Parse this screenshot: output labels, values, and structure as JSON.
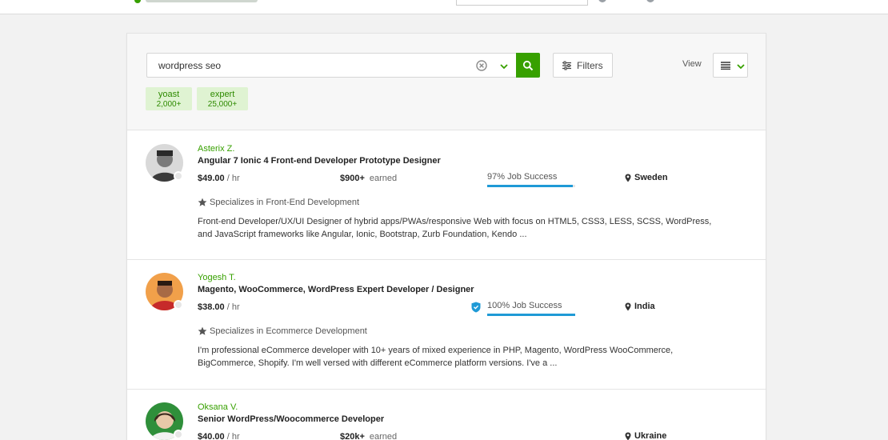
{
  "colors": {
    "brand": "#37a000",
    "success_bar": "#1f9ad6",
    "chip_bg": "#dff3d2"
  },
  "search": {
    "value": "wordpress seo",
    "placeholder": ""
  },
  "toolbar": {
    "filters_label": "Filters",
    "view_label": "View"
  },
  "chips": [
    {
      "name": "yoast",
      "count": "2,000+"
    },
    {
      "name": "expert",
      "count": "25,000+"
    }
  ],
  "results": [
    {
      "name": "Asterix Z.",
      "title": "Angular 7 Ionic 4 Front-end Developer Prototype Designer",
      "rate": "$49.00",
      "rate_unit": " / hr",
      "earned_amount": "$900+",
      "earned_label": "earned",
      "job_success": "97% Job Success",
      "job_success_pct": 97,
      "location": "Sweden",
      "specializes": "Specializes in Front-End Development",
      "description": "Front-end Developer/UX/UI Designer of hybrid apps/PWAs/responsive Web with focus on HTML5, CSS3, LESS, SCSS, WordPress, and JavaScript frameworks like Angular, Ionic, Bootstrap, Zurb Foundation, Kendo ..."
    },
    {
      "name": "Yogesh T.",
      "title": "Magento, WooCommerce, WordPress Expert Developer / Designer",
      "rate": "$38.00",
      "rate_unit": " / hr",
      "job_success": "100% Job Success",
      "job_success_pct": 100,
      "location": "India",
      "specializes": "Specializes in Ecommerce Development",
      "description": "I'm professional eCommerce developer with 10+ years of mixed experience in PHP, Magento, WordPress WooCommerce, BigCommerce, Shopify. I'm well versed with different eCommerce platform versions. I've a ..."
    },
    {
      "name": "Oksana V.",
      "title": "Senior WordPress/Woocommerce Developer",
      "rate": "$40.00",
      "rate_unit": " / hr",
      "earned_amount": "$20k+",
      "earned_label": "earned",
      "location": "Ukraine"
    }
  ]
}
